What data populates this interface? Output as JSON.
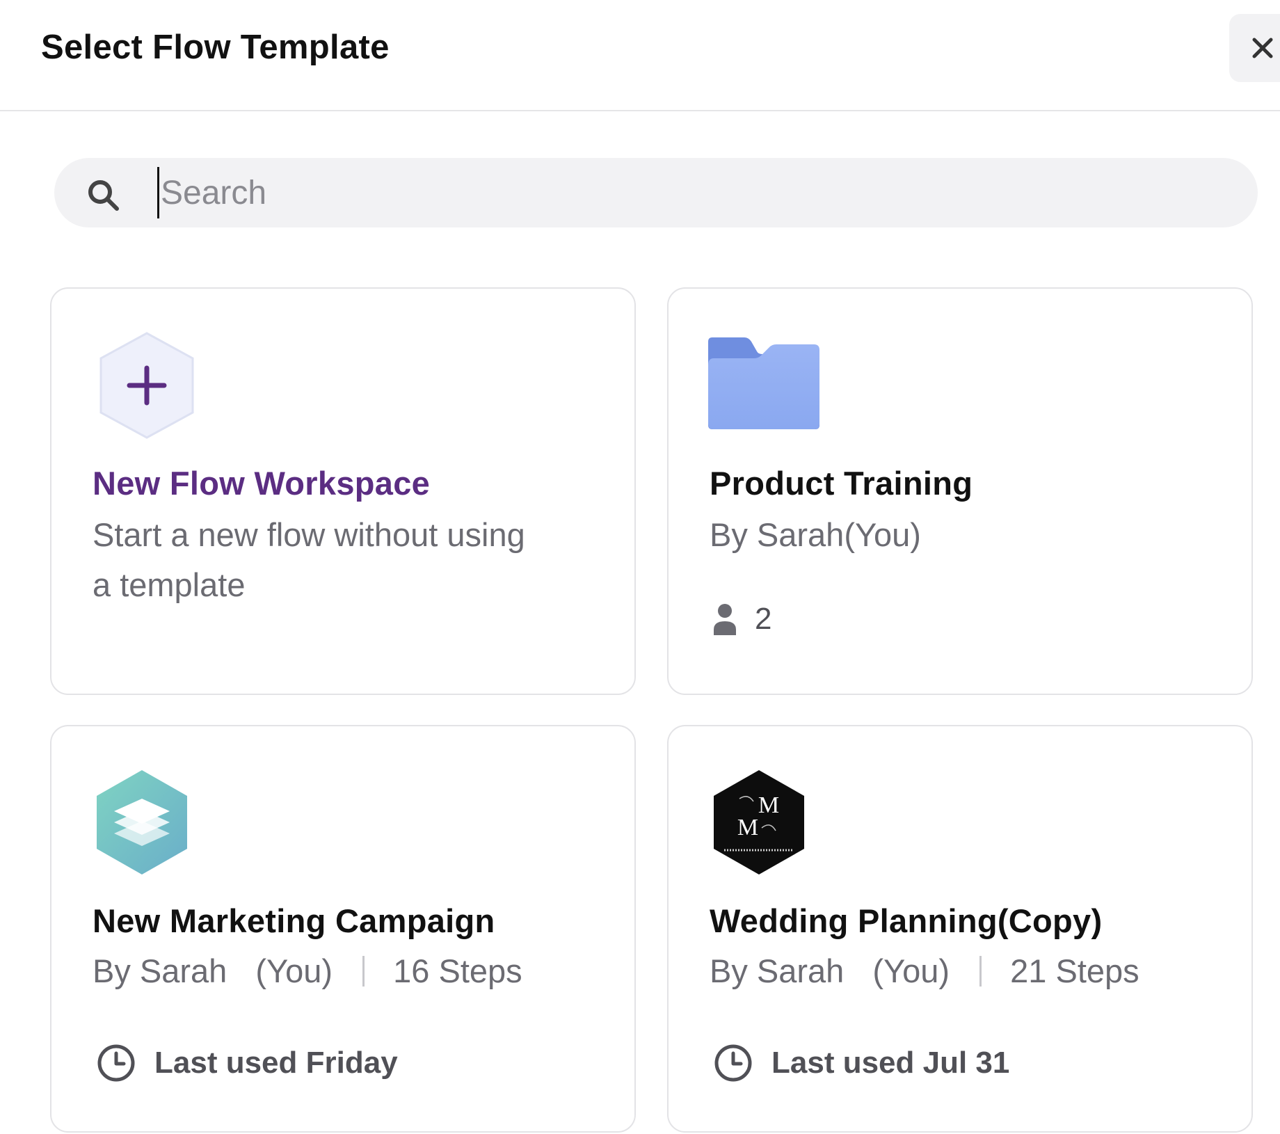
{
  "header": {
    "title": "Select Flow Template",
    "close_icon": "close-icon"
  },
  "search": {
    "placeholder": "Search",
    "value": "",
    "icon": "search-icon"
  },
  "cards": [
    {
      "icon": "plus-hexagon-icon",
      "title": "New Flow Workspace",
      "description_line1": "Start a new flow without using",
      "description_line2": "a template",
      "accent_color": "#5b2d82"
    },
    {
      "icon": "folder-icon",
      "title": "Product Training",
      "author": "By Sarah(You)",
      "members_icon": "person-icon",
      "members": "2"
    },
    {
      "icon": "layers-hexagon-icon",
      "title": "New Marketing Campaign",
      "author_name": "By Sarah",
      "author_you": "(You)",
      "steps": "16 Steps",
      "clock_icon": "clock-icon",
      "last_used": "Last used Friday"
    },
    {
      "icon": "monogram-hexagon-logo",
      "logo_text_top": "M",
      "logo_text_bottom": "M",
      "title": "Wedding Planning(Copy)",
      "author_name": "By Sarah",
      "author_you": "(You)",
      "steps": "21 Steps",
      "clock_icon": "clock-icon",
      "last_used": "Last used Jul 31"
    }
  ]
}
